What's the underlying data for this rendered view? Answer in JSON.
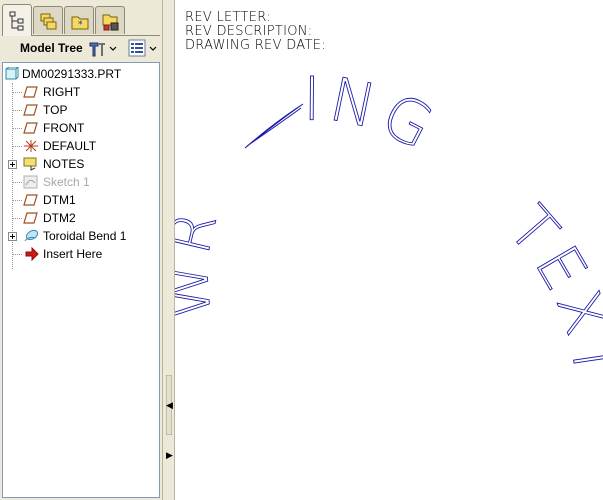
{
  "tabs": [
    {
      "icon": "model-tree-tab-icon",
      "active": true
    },
    {
      "icon": "layers-tab-icon",
      "active": false
    },
    {
      "icon": "favorites-tab-icon",
      "active": false
    },
    {
      "icon": "tools-tab-icon",
      "active": false
    }
  ],
  "model_tree": {
    "header_label": "Model Tree",
    "root": "DM00291333.PRT",
    "items": [
      {
        "label": "RIGHT",
        "icon": "datum-plane-icon"
      },
      {
        "label": "TOP",
        "icon": "datum-plane-icon"
      },
      {
        "label": "FRONT",
        "icon": "datum-plane-icon"
      },
      {
        "label": "DEFAULT",
        "icon": "coordinate-system-icon"
      },
      {
        "label": "NOTES",
        "icon": "notes-folder-icon",
        "expandable": true
      },
      {
        "label": "Sketch 1",
        "icon": "sketch-icon",
        "suppressed": true
      },
      {
        "label": "DTM1",
        "icon": "datum-plane-icon"
      },
      {
        "label": "DTM2",
        "icon": "datum-plane-icon"
      },
      {
        "label": "Toroidal Bend 1",
        "icon": "toroidal-bend-icon",
        "expandable": true
      },
      {
        "label": "Insert Here",
        "icon": "insert-arrow-icon"
      }
    ]
  },
  "notes": {
    "rev_letter": "REV LETTER:",
    "rev_description": "REV DESCRIPTION:",
    "drawing_rev_date": "DRAWING REV DATE:"
  },
  "bent_text": [
    "WR",
    "ING",
    "TEXT"
  ],
  "colors": {
    "panel_bg": "#ece9d8",
    "tree_border": "#7f9db9",
    "curve_color": "#1a1aa8",
    "datum_plane": "#a05020"
  }
}
